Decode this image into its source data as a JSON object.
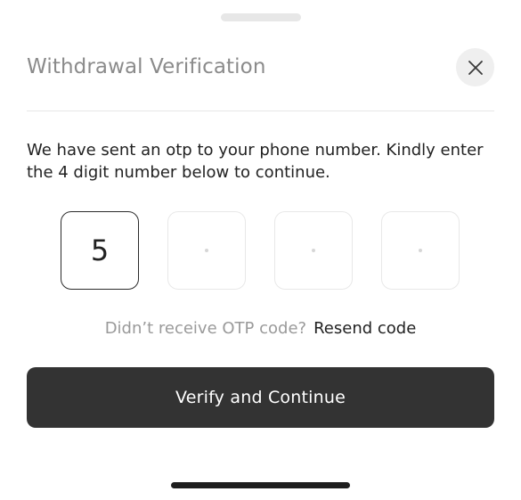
{
  "sheet": {
    "title": "Withdrawal Verification",
    "close_icon": "close-icon"
  },
  "message": "We have sent an otp to your phone number. Kindly enter the 4 digit number below to continue.",
  "otp": {
    "digits": [
      "5",
      "",
      "",
      ""
    ],
    "empty_placeholder": "·"
  },
  "resend": {
    "prompt": "Didn’t receive OTP code?",
    "link_label": "Resend code"
  },
  "verify_button": {
    "label": "Verify and Continue"
  },
  "colors": {
    "title": "#8b8b8b",
    "primary_button": "#333333",
    "active_border": "#2b2b2b",
    "inactive_border": "#e8e8e8"
  }
}
